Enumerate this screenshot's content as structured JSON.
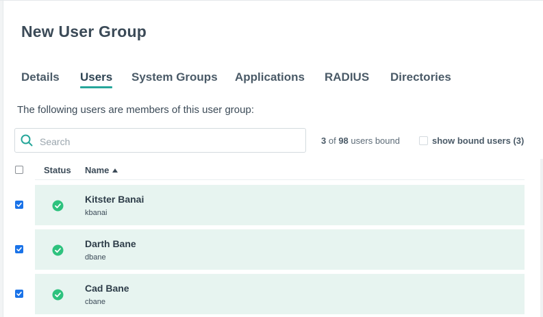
{
  "dialog": {
    "title": "New User Group"
  },
  "tabs": [
    "Details",
    "Users",
    "System Groups",
    "Applications",
    "RADIUS",
    "Directories"
  ],
  "active_tab": "Users",
  "intro_text": "The following users are members of this user group:",
  "search": {
    "placeholder": "Search",
    "value": ""
  },
  "summary": {
    "bound": "3",
    "of_label": "of",
    "total": "98",
    "suffix": "users bound"
  },
  "bound_toggle": {
    "label": "show bound users (3)",
    "checked": false
  },
  "table": {
    "columns": {
      "status": "Status",
      "name": "Name"
    },
    "sort": {
      "column": "Name",
      "direction": "ascending"
    },
    "select_all_checked": false,
    "rows": [
      {
        "name": "Kitster Banai",
        "username": "kbanai",
        "checked": true,
        "status": "active"
      },
      {
        "name": "Darth Bane",
        "username": "dbane",
        "checked": true,
        "status": "active"
      },
      {
        "name": "Cad Bane",
        "username": "cbane",
        "checked": true,
        "status": "active"
      }
    ]
  },
  "colors": {
    "accent": "#26a69a",
    "row_bg": "#e7f4f0",
    "checkbox": "#1a73e8",
    "status_active": "#2ec27e"
  }
}
